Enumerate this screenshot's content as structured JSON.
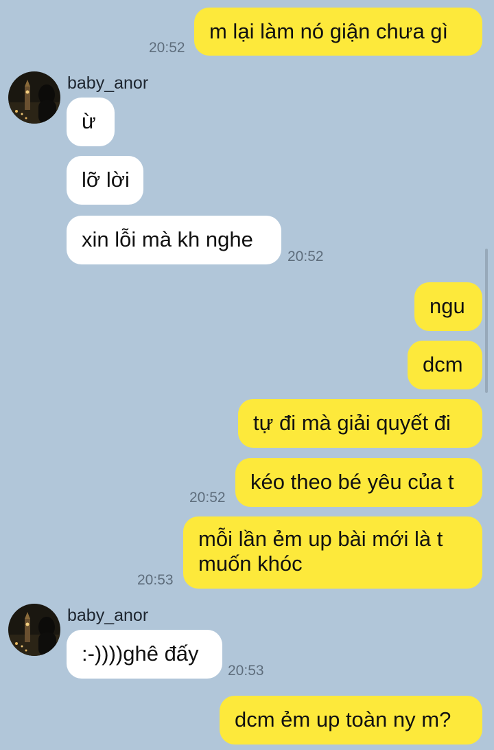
{
  "contact": {
    "name": "baby_anor"
  },
  "messages": [
    {
      "from": "me",
      "text": "m lại làm nó giận chưa gì",
      "time": "20:52"
    },
    {
      "from": "them",
      "text": "ừ"
    },
    {
      "from": "them",
      "text": "lỡ lời"
    },
    {
      "from": "them",
      "text": "xin lỗi mà kh nghe",
      "time": "20:52"
    },
    {
      "from": "me",
      "text": "ngu"
    },
    {
      "from": "me",
      "text": "dcm"
    },
    {
      "from": "me",
      "text": "tự đi mà giải quyết đi"
    },
    {
      "from": "me",
      "text": "kéo theo bé yêu của t",
      "time": "20:52"
    },
    {
      "from": "me",
      "text": "mỗi lần ẻm up bài mới là t muốn khóc",
      "line1": "mỗi lần ẻm up bài mới là t",
      "line2": "muốn khóc",
      "time": "20:53"
    },
    {
      "from": "them",
      "text": ":-))))ghê đấy",
      "time": "20:53"
    },
    {
      "from": "me",
      "text": "dcm ẻm up toàn ny m?"
    }
  ],
  "colors": {
    "background": "#b1c6d9",
    "outgoing": "#fde93b",
    "incoming": "#ffffff"
  },
  "icons": {
    "avatar": "avatar-photo-night-city"
  }
}
